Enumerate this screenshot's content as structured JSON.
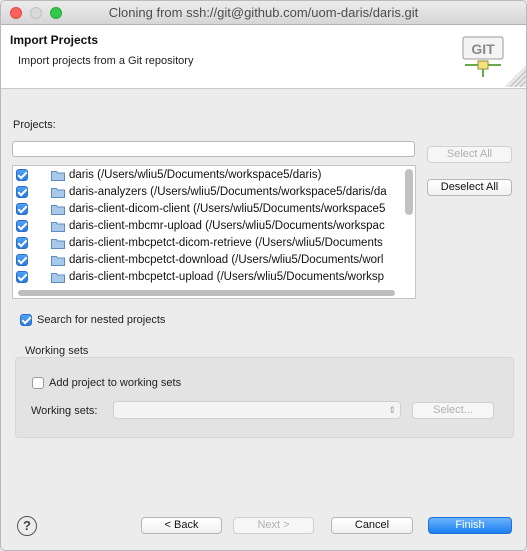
{
  "window": {
    "title": "Cloning from ssh://git@github.com/uom-daris/daris.git"
  },
  "header": {
    "title": "Import Projects",
    "description": "Import projects from a Git repository",
    "logo_text": "GIT"
  },
  "projects": {
    "label": "Projects:",
    "filter_value": "",
    "items": [
      {
        "label": "daris (/Users/wliu5/Documents/workspace5/daris)",
        "checked": true
      },
      {
        "label": "daris-analyzers (/Users/wliu5/Documents/workspace5/daris/da",
        "checked": true
      },
      {
        "label": "daris-client-dicom-client (/Users/wliu5/Documents/workspace5",
        "checked": true
      },
      {
        "label": "daris-client-mbcmr-upload (/Users/wliu5/Documents/workspac",
        "checked": true
      },
      {
        "label": "daris-client-mbcpetct-dicom-retrieve (/Users/wliu5/Documents",
        "checked": true
      },
      {
        "label": "daris-client-mbcpetct-download (/Users/wliu5/Documents/worl",
        "checked": true
      },
      {
        "label": "daris-client-mbcpetct-upload (/Users/wliu5/Documents/worksp",
        "checked": true
      }
    ],
    "select_all_label": "Select All",
    "deselect_all_label": "Deselect All"
  },
  "nested": {
    "label": "Search for nested projects",
    "checked": true
  },
  "working_sets": {
    "group_label": "Working sets",
    "add_label": "Add project to working sets",
    "add_checked": false,
    "field_label": "Working sets:",
    "select_label": "Select..."
  },
  "footer": {
    "help_symbol": "?",
    "back_label": "< Back",
    "next_label": "Next >",
    "cancel_label": "Cancel",
    "finish_label": "Finish"
  },
  "colors": {
    "accent": "#2a7ae2",
    "close": "#fc605c",
    "zoom": "#34c84a"
  }
}
